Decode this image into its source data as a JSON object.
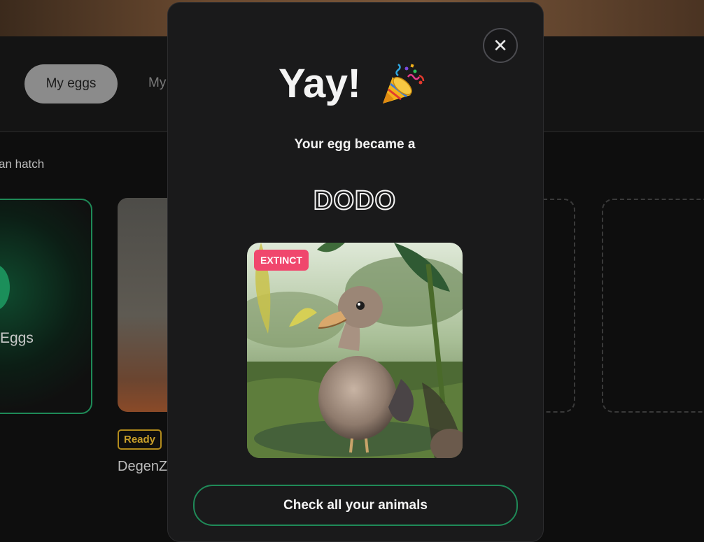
{
  "background": {
    "tabs": {
      "active": "My eggs",
      "other": "My"
    },
    "hatch_text": "an hatch",
    "eggs_label": "Eggs",
    "ready_badge": "Ready",
    "card_name": "DegenZ"
  },
  "modal": {
    "heading": "Yay!",
    "subtitle": "Your egg became a",
    "species": "DODO",
    "badge": "EXTINCT",
    "cta_label": "Check all your animals",
    "close_icon": "close-icon",
    "party_icon": "party-popper-icon"
  },
  "colors": {
    "accent_green": "#1f8a58",
    "extinct_pink": "#f0476d",
    "ready_gold": "#b28b1c"
  }
}
